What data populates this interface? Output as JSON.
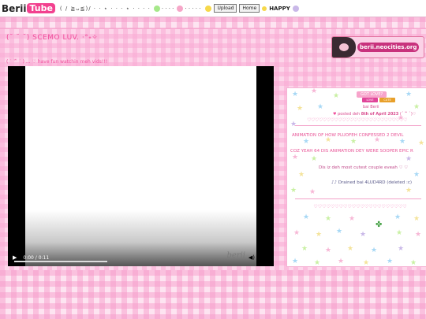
{
  "header": {
    "logo_part1": "Berii",
    "logo_part2": "Tube",
    "nav_deco": "( /  ≧ᴗ≦)/ · · ⋆ · · · ⋆ · · · ·",
    "upload_label": "Upload",
    "home_label": "Home",
    "happy_label": "HAPPY"
  },
  "page": {
    "title": "(˘ ˘ ˘) SCEMO LUV. ·°˖✧",
    "subtitle": "( ˙ ꒳ ˙ ) ... ♡  have fun watchin meh vids!!!",
    "banner_text": "berii.neocities.org"
  },
  "player": {
    "time": "0:00 / 0:11",
    "watermark": "berii",
    "progress": 0.0
  },
  "sidebar": {
    "got_love": "GOT LOVE?",
    "badge1": "LOVE",
    "badge2": "CUTE",
    "bai": "bai Berii",
    "posted_prefix": "posted deh",
    "posted_date": "8th of April 2023",
    "posted_suffix": "(´ ꒳ `)♡",
    "hearts": "♡♡♡♡♡♡♡♡♡♡♡♡♡♡♡♡♡♡♡♡♡♡♡♡♡♡",
    "scroll1": "ANIMATION OF HOW PLUOFEH CONFESSED 2 DEVIL",
    "scroll2": "COZ YEAH 64 DIS ANIMATION DEY WERE SOOPER EPIC R",
    "desc": "Dis iz deh most cutest couple eveah ♡ ♡",
    "music": "Drained bai 4LUD4RD (deleted :c)",
    "hearts2": "♡♡♡♡♡♡♡♡♡♡♡♡♡♡♡♡♡♡♡♡♡♡"
  },
  "colors": {
    "accent": "#f04d9b",
    "pink_light": "#fde4f1",
    "pink_check": "#f696c8"
  }
}
